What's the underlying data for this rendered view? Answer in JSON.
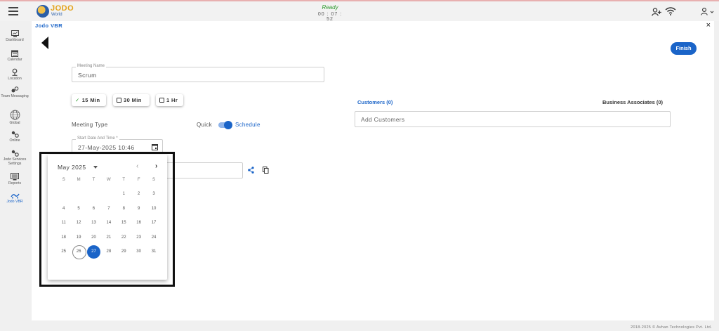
{
  "topbar": {
    "logo_text": "JODO",
    "logo_sub": "World",
    "status_text": "Ready",
    "timer": "00 : 07 : 52"
  },
  "sidebar": {
    "items": [
      {
        "label": "Dashboard",
        "icon": "dashboard-icon"
      },
      {
        "label": "Calendar",
        "icon": "calendar-icon"
      },
      {
        "label": "Location",
        "icon": "location-icon"
      },
      {
        "label": "Team Messaging",
        "icon": "team-messaging-icon"
      },
      {
        "label": "Global",
        "icon": "globe-icon"
      },
      {
        "label": "Online",
        "icon": "online-icon"
      },
      {
        "label": "Jodo Services Settings",
        "icon": "services-settings-icon"
      },
      {
        "label": "Reports",
        "icon": "reports-icon"
      },
      {
        "label": "Jodo VBR",
        "icon": "vbr-icon"
      }
    ]
  },
  "panel": {
    "title": "Jodo VBR",
    "close": "×",
    "finish_label": "Finish"
  },
  "meeting": {
    "name_label": "Meeting Name",
    "name_value": "Scrum",
    "durations": [
      {
        "label": "15 Min",
        "selected": true
      },
      {
        "label": "30 Min",
        "selected": false
      },
      {
        "label": "1 Hr",
        "selected": false
      }
    ],
    "type_label": "Meeting Type",
    "quick_label": "Quick",
    "schedule_label": "Schedule",
    "start_label": "Start Date And Time *",
    "start_value": "27-May-2025 10:46"
  },
  "customers": {
    "tab_customers": "Customers (0)",
    "tab_associates": "Business Associates (0)",
    "add_placeholder": "Add Customers"
  },
  "datepicker": {
    "month_label": "May 2025",
    "prev": "‹",
    "next": "›",
    "weekdays": [
      "S",
      "M",
      "T",
      "W",
      "T",
      "F",
      "S"
    ],
    "weeks": [
      [
        "",
        "",
        "",
        "",
        "1",
        "2",
        "3"
      ],
      [
        "4",
        "5",
        "6",
        "7",
        "8",
        "9",
        "10"
      ],
      [
        "11",
        "12",
        "13",
        "14",
        "15",
        "16",
        "17"
      ],
      [
        "18",
        "19",
        "20",
        "21",
        "22",
        "23",
        "24"
      ],
      [
        "25",
        "26",
        "27",
        "28",
        "29",
        "30",
        "31"
      ]
    ],
    "today": "26",
    "selected": "27"
  },
  "footer": "2018-2025 © Avhan Technologies Pvt. Ltd.",
  "colors": {
    "accent": "#1a64c8",
    "ready": "#2e9b2e",
    "logo": "#e3a21a"
  }
}
